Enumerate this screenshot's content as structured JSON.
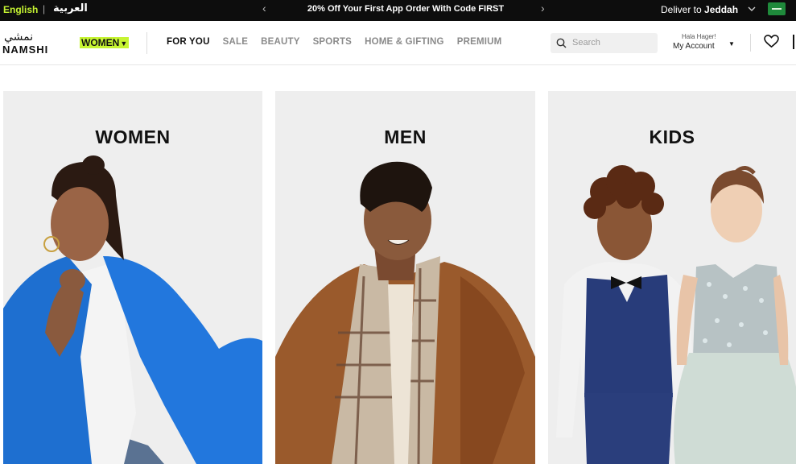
{
  "topbar": {
    "lang_en": "English",
    "lang_sep": "|",
    "lang_ar": "العربية",
    "promo": "20% Off Your First App Order With Code FIRST",
    "deliver_prefix": "Deliver to",
    "deliver_city": "Jeddah"
  },
  "brand": {
    "logo_ar": "نمشي",
    "logo_en": "NAMSHI"
  },
  "nav": {
    "gender": "WOMEN",
    "links": [
      "FOR YOU",
      "SALE",
      "BEAUTY",
      "SPORTS",
      "HOME & GIFTING",
      "PREMIUM"
    ]
  },
  "search": {
    "placeholder": "Search"
  },
  "account": {
    "greeting": "Hala Hager!",
    "label": "My Account"
  },
  "categories": [
    {
      "title": "WOMEN"
    },
    {
      "title": "MEN"
    },
    {
      "title": "KIDS"
    }
  ],
  "colors": {
    "accent": "#c6f432",
    "topbar": "#0d0d0d",
    "card_bg": "#eeeeee"
  },
  "icons": [
    "chevron-left-icon",
    "chevron-right-icon",
    "chevron-down-icon",
    "flag-icon",
    "search-icon",
    "heart-icon",
    "bag-icon"
  ]
}
